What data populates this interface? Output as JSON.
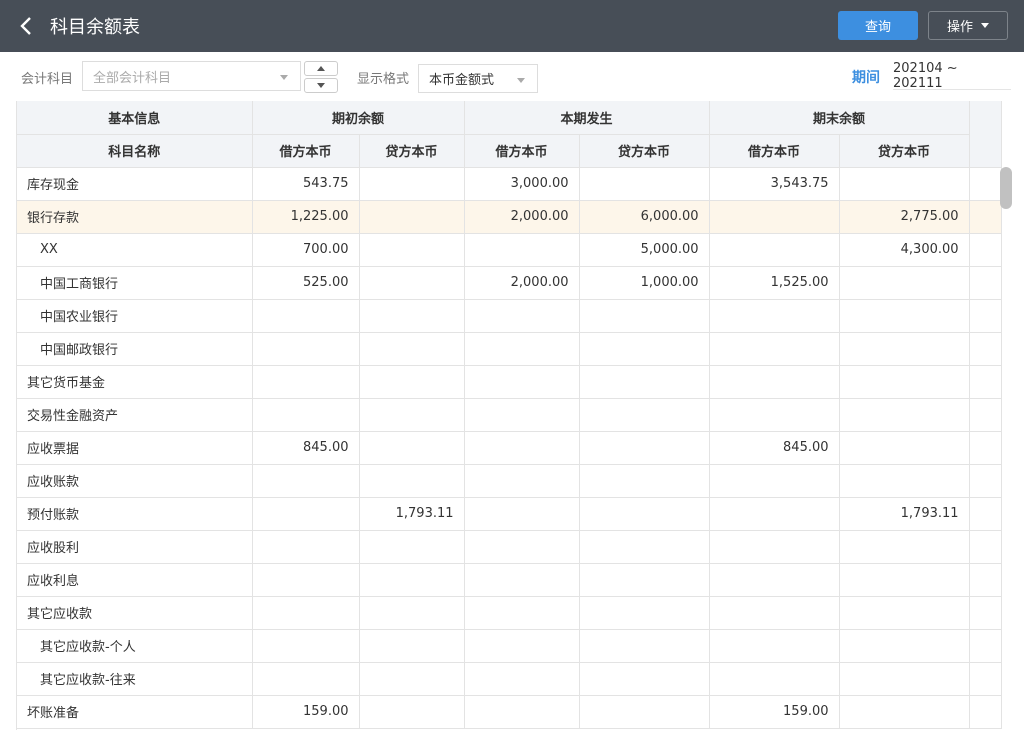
{
  "header": {
    "title": "科目余额表",
    "query_label": "查询",
    "ops_label": "操作"
  },
  "filter": {
    "subject_label": "会计科目",
    "subject_placeholder": "全部会计科目",
    "format_label": "显示格式",
    "format_value": "本币金额式",
    "period_label": "期间",
    "period_value": "202104 ~ 202111"
  },
  "table": {
    "group_headers": [
      "基本信息",
      "期初余额",
      "本期发生",
      "期末余额"
    ],
    "sub_headers": [
      "科目名称",
      "借方本币",
      "贷方本币",
      "借方本币",
      "贷方本币",
      "借方本币",
      "贷方本币"
    ],
    "rows": [
      {
        "name": "库存现金",
        "indent": false,
        "highlight": false,
        "v": [
          "543.75",
          "",
          "3,000.00",
          "",
          "3,543.75",
          ""
        ]
      },
      {
        "name": "银行存款",
        "indent": false,
        "highlight": true,
        "v": [
          "1,225.00",
          "",
          "2,000.00",
          "6,000.00",
          "",
          "2,775.00"
        ]
      },
      {
        "name": "XX",
        "indent": true,
        "highlight": false,
        "v": [
          "700.00",
          "",
          "",
          "5,000.00",
          "",
          "4,300.00"
        ]
      },
      {
        "name": "中国工商银行",
        "indent": true,
        "highlight": false,
        "v": [
          "525.00",
          "",
          "2,000.00",
          "1,000.00",
          "1,525.00",
          ""
        ]
      },
      {
        "name": "中国农业银行",
        "indent": true,
        "highlight": false,
        "v": [
          "",
          "",
          "",
          "",
          "",
          ""
        ]
      },
      {
        "name": "中国邮政银行",
        "indent": true,
        "highlight": false,
        "v": [
          "",
          "",
          "",
          "",
          "",
          ""
        ]
      },
      {
        "name": "其它货币基金",
        "indent": false,
        "highlight": false,
        "v": [
          "",
          "",
          "",
          "",
          "",
          ""
        ]
      },
      {
        "name": "交易性金融资产",
        "indent": false,
        "highlight": false,
        "v": [
          "",
          "",
          "",
          "",
          "",
          ""
        ]
      },
      {
        "name": "应收票据",
        "indent": false,
        "highlight": false,
        "v": [
          "845.00",
          "",
          "",
          "",
          "845.00",
          ""
        ]
      },
      {
        "name": "应收账款",
        "indent": false,
        "highlight": false,
        "v": [
          "",
          "",
          "",
          "",
          "",
          ""
        ]
      },
      {
        "name": "预付账款",
        "indent": false,
        "highlight": false,
        "v": [
          "",
          "1,793.11",
          "",
          "",
          "",
          "1,793.11"
        ]
      },
      {
        "name": "应收股利",
        "indent": false,
        "highlight": false,
        "v": [
          "",
          "",
          "",
          "",
          "",
          ""
        ]
      },
      {
        "name": "应收利息",
        "indent": false,
        "highlight": false,
        "v": [
          "",
          "",
          "",
          "",
          "",
          ""
        ]
      },
      {
        "name": "其它应收款",
        "indent": false,
        "highlight": false,
        "v": [
          "",
          "",
          "",
          "",
          "",
          ""
        ]
      },
      {
        "name": "其它应收款-个人",
        "indent": true,
        "highlight": false,
        "v": [
          "",
          "",
          "",
          "",
          "",
          ""
        ]
      },
      {
        "name": "其它应收款-往来",
        "indent": true,
        "highlight": false,
        "v": [
          "",
          "",
          "",
          "",
          "",
          ""
        ]
      },
      {
        "name": "坏账准备",
        "indent": false,
        "highlight": false,
        "v": [
          "159.00",
          "",
          "",
          "",
          "159.00",
          ""
        ]
      }
    ]
  }
}
